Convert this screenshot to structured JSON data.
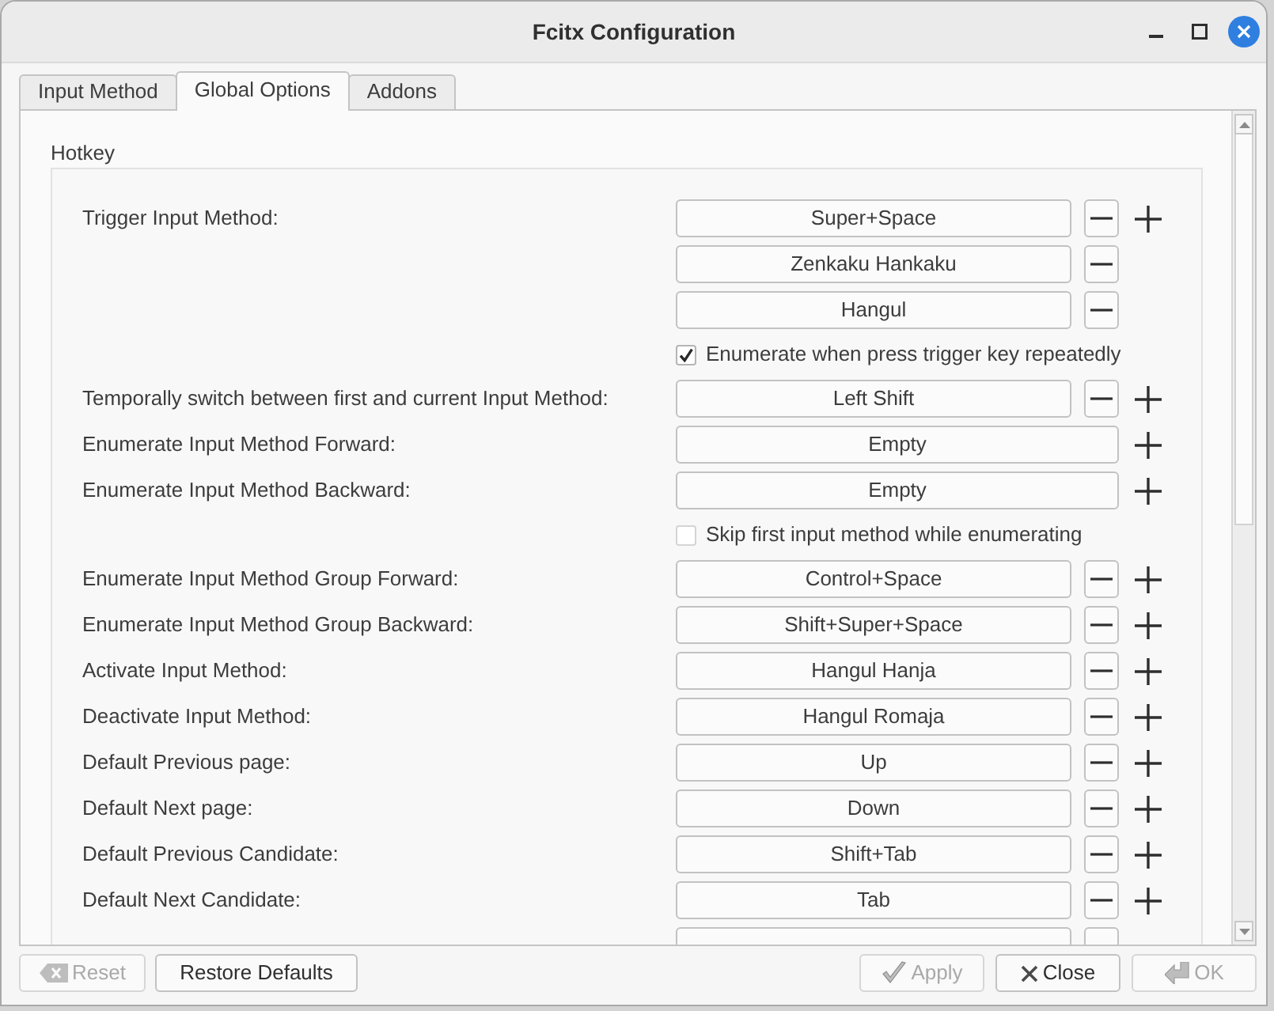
{
  "window": {
    "title": "Fcitx Configuration"
  },
  "tabs": [
    {
      "label": "Input Method",
      "selected": false
    },
    {
      "label": "Global Options",
      "selected": true
    },
    {
      "label": "Addons",
      "selected": false
    }
  ],
  "group": {
    "title": "Hotkey",
    "rows": [
      {
        "kind": "hotkey",
        "label": "Trigger Input Method:",
        "keys": [
          {
            "value": "Super+Space",
            "removable": true
          },
          {
            "value": "Zenkaku Hankaku",
            "removable": true
          },
          {
            "value": "Hangul",
            "removable": true
          }
        ]
      },
      {
        "kind": "checkbox",
        "label": "Enumerate when press trigger key repeatedly",
        "checked": true
      },
      {
        "kind": "hotkey",
        "label": "Temporally switch between first and current Input Method:",
        "keys": [
          {
            "value": "Left Shift",
            "removable": true
          }
        ]
      },
      {
        "kind": "hotkey",
        "label": "Enumerate Input Method Forward:",
        "keys": [
          {
            "value": "Empty",
            "removable": false
          }
        ]
      },
      {
        "kind": "hotkey",
        "label": "Enumerate Input Method Backward:",
        "keys": [
          {
            "value": "Empty",
            "removable": false
          }
        ]
      },
      {
        "kind": "checkbox",
        "label": "Skip first input method while enumerating",
        "checked": false
      },
      {
        "kind": "hotkey",
        "label": "Enumerate Input Method Group Forward:",
        "keys": [
          {
            "value": "Control+Space",
            "removable": true
          }
        ]
      },
      {
        "kind": "hotkey",
        "label": "Enumerate Input Method Group Backward:",
        "keys": [
          {
            "value": "Shift+Super+Space",
            "removable": true
          }
        ]
      },
      {
        "kind": "hotkey",
        "label": "Activate Input Method:",
        "keys": [
          {
            "value": "Hangul Hanja",
            "removable": true
          }
        ]
      },
      {
        "kind": "hotkey",
        "label": "Deactivate Input Method:",
        "keys": [
          {
            "value": "Hangul Romaja",
            "removable": true
          }
        ]
      },
      {
        "kind": "hotkey",
        "label": "Default Previous page:",
        "keys": [
          {
            "value": "Up",
            "removable": true
          }
        ]
      },
      {
        "kind": "hotkey",
        "label": "Default Next page:",
        "keys": [
          {
            "value": "Down",
            "removable": true
          }
        ]
      },
      {
        "kind": "hotkey",
        "label": "Default Previous Candidate:",
        "keys": [
          {
            "value": "Shift+Tab",
            "removable": true
          }
        ]
      },
      {
        "kind": "hotkey",
        "label": "Default Next Candidate:",
        "keys": [
          {
            "value": "Tab",
            "removable": true
          }
        ]
      },
      {
        "kind": "cut",
        "keys": [
          {
            "removable": true
          }
        ]
      }
    ]
  },
  "footer": {
    "left": [
      {
        "kind": "reset",
        "label": "Reset",
        "disabled": true
      },
      {
        "kind": "restore",
        "label": "Restore Defaults",
        "disabled": false
      }
    ],
    "right": [
      {
        "kind": "apply",
        "label": "Apply",
        "disabled": true
      },
      {
        "kind": "close",
        "label": "Close",
        "disabled": false
      },
      {
        "kind": "ok",
        "label": "OK",
        "disabled": true
      }
    ]
  }
}
